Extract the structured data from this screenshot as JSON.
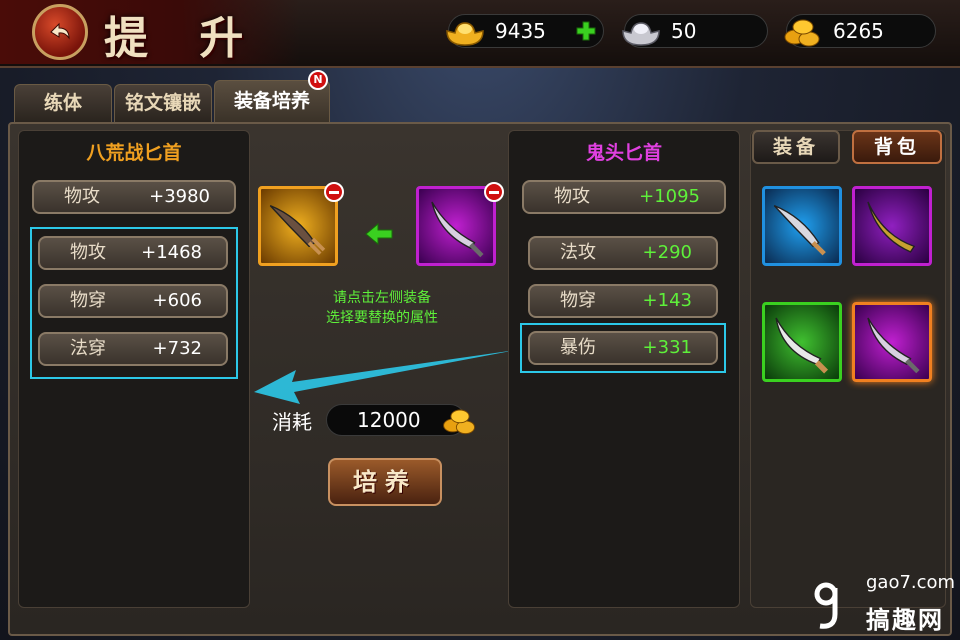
{
  "header": {
    "title": "提 升",
    "currencies": [
      {
        "icon": "gold-ingot-icon",
        "value": "9435",
        "has_plus": true
      },
      {
        "icon": "silver-ingot-icon",
        "value": "50",
        "has_plus": false
      },
      {
        "icon": "gold-coins-icon",
        "value": "6265",
        "has_plus": false
      }
    ]
  },
  "tabs": [
    {
      "label": "练体",
      "active": false
    },
    {
      "label": "铭文镶嵌",
      "active": false
    },
    {
      "label": "装备培养",
      "active": true,
      "badge": "N"
    }
  ],
  "left_item": {
    "name": "八荒战匕首",
    "name_color": "#f0a020",
    "main_stat": {
      "name": "物攻",
      "value": "+3980"
    },
    "sub_stats": [
      {
        "name": "物攻",
        "value": "+1468"
      },
      {
        "name": "物穿",
        "value": "+606"
      },
      {
        "name": "法穿",
        "value": "+732"
      }
    ]
  },
  "right_item": {
    "name": "鬼头匕首",
    "name_color": "#e040e0",
    "main_stat": {
      "name": "物攻",
      "value": "+1095"
    },
    "sub_stats": [
      {
        "name": "法攻",
        "value": "+290"
      },
      {
        "name": "物穿",
        "value": "+143"
      },
      {
        "name": "暴伤",
        "value": "+331"
      }
    ]
  },
  "center": {
    "hint_line1": "请点击左侧装备",
    "hint_line2": "选择要替换的属性",
    "cost_label": "消耗",
    "cost_value": "12000",
    "action_label": "培养"
  },
  "sidebar": {
    "equip_label": "装备",
    "bag_label": "背包"
  },
  "watermark": {
    "domain": "gao7.com",
    "name": "搞趣网"
  },
  "colors": {
    "highlight": "#2cc8e8",
    "green_value": "#5ef03a",
    "orange_frame": "#f0a020",
    "purple_frame": "#c020d0"
  }
}
